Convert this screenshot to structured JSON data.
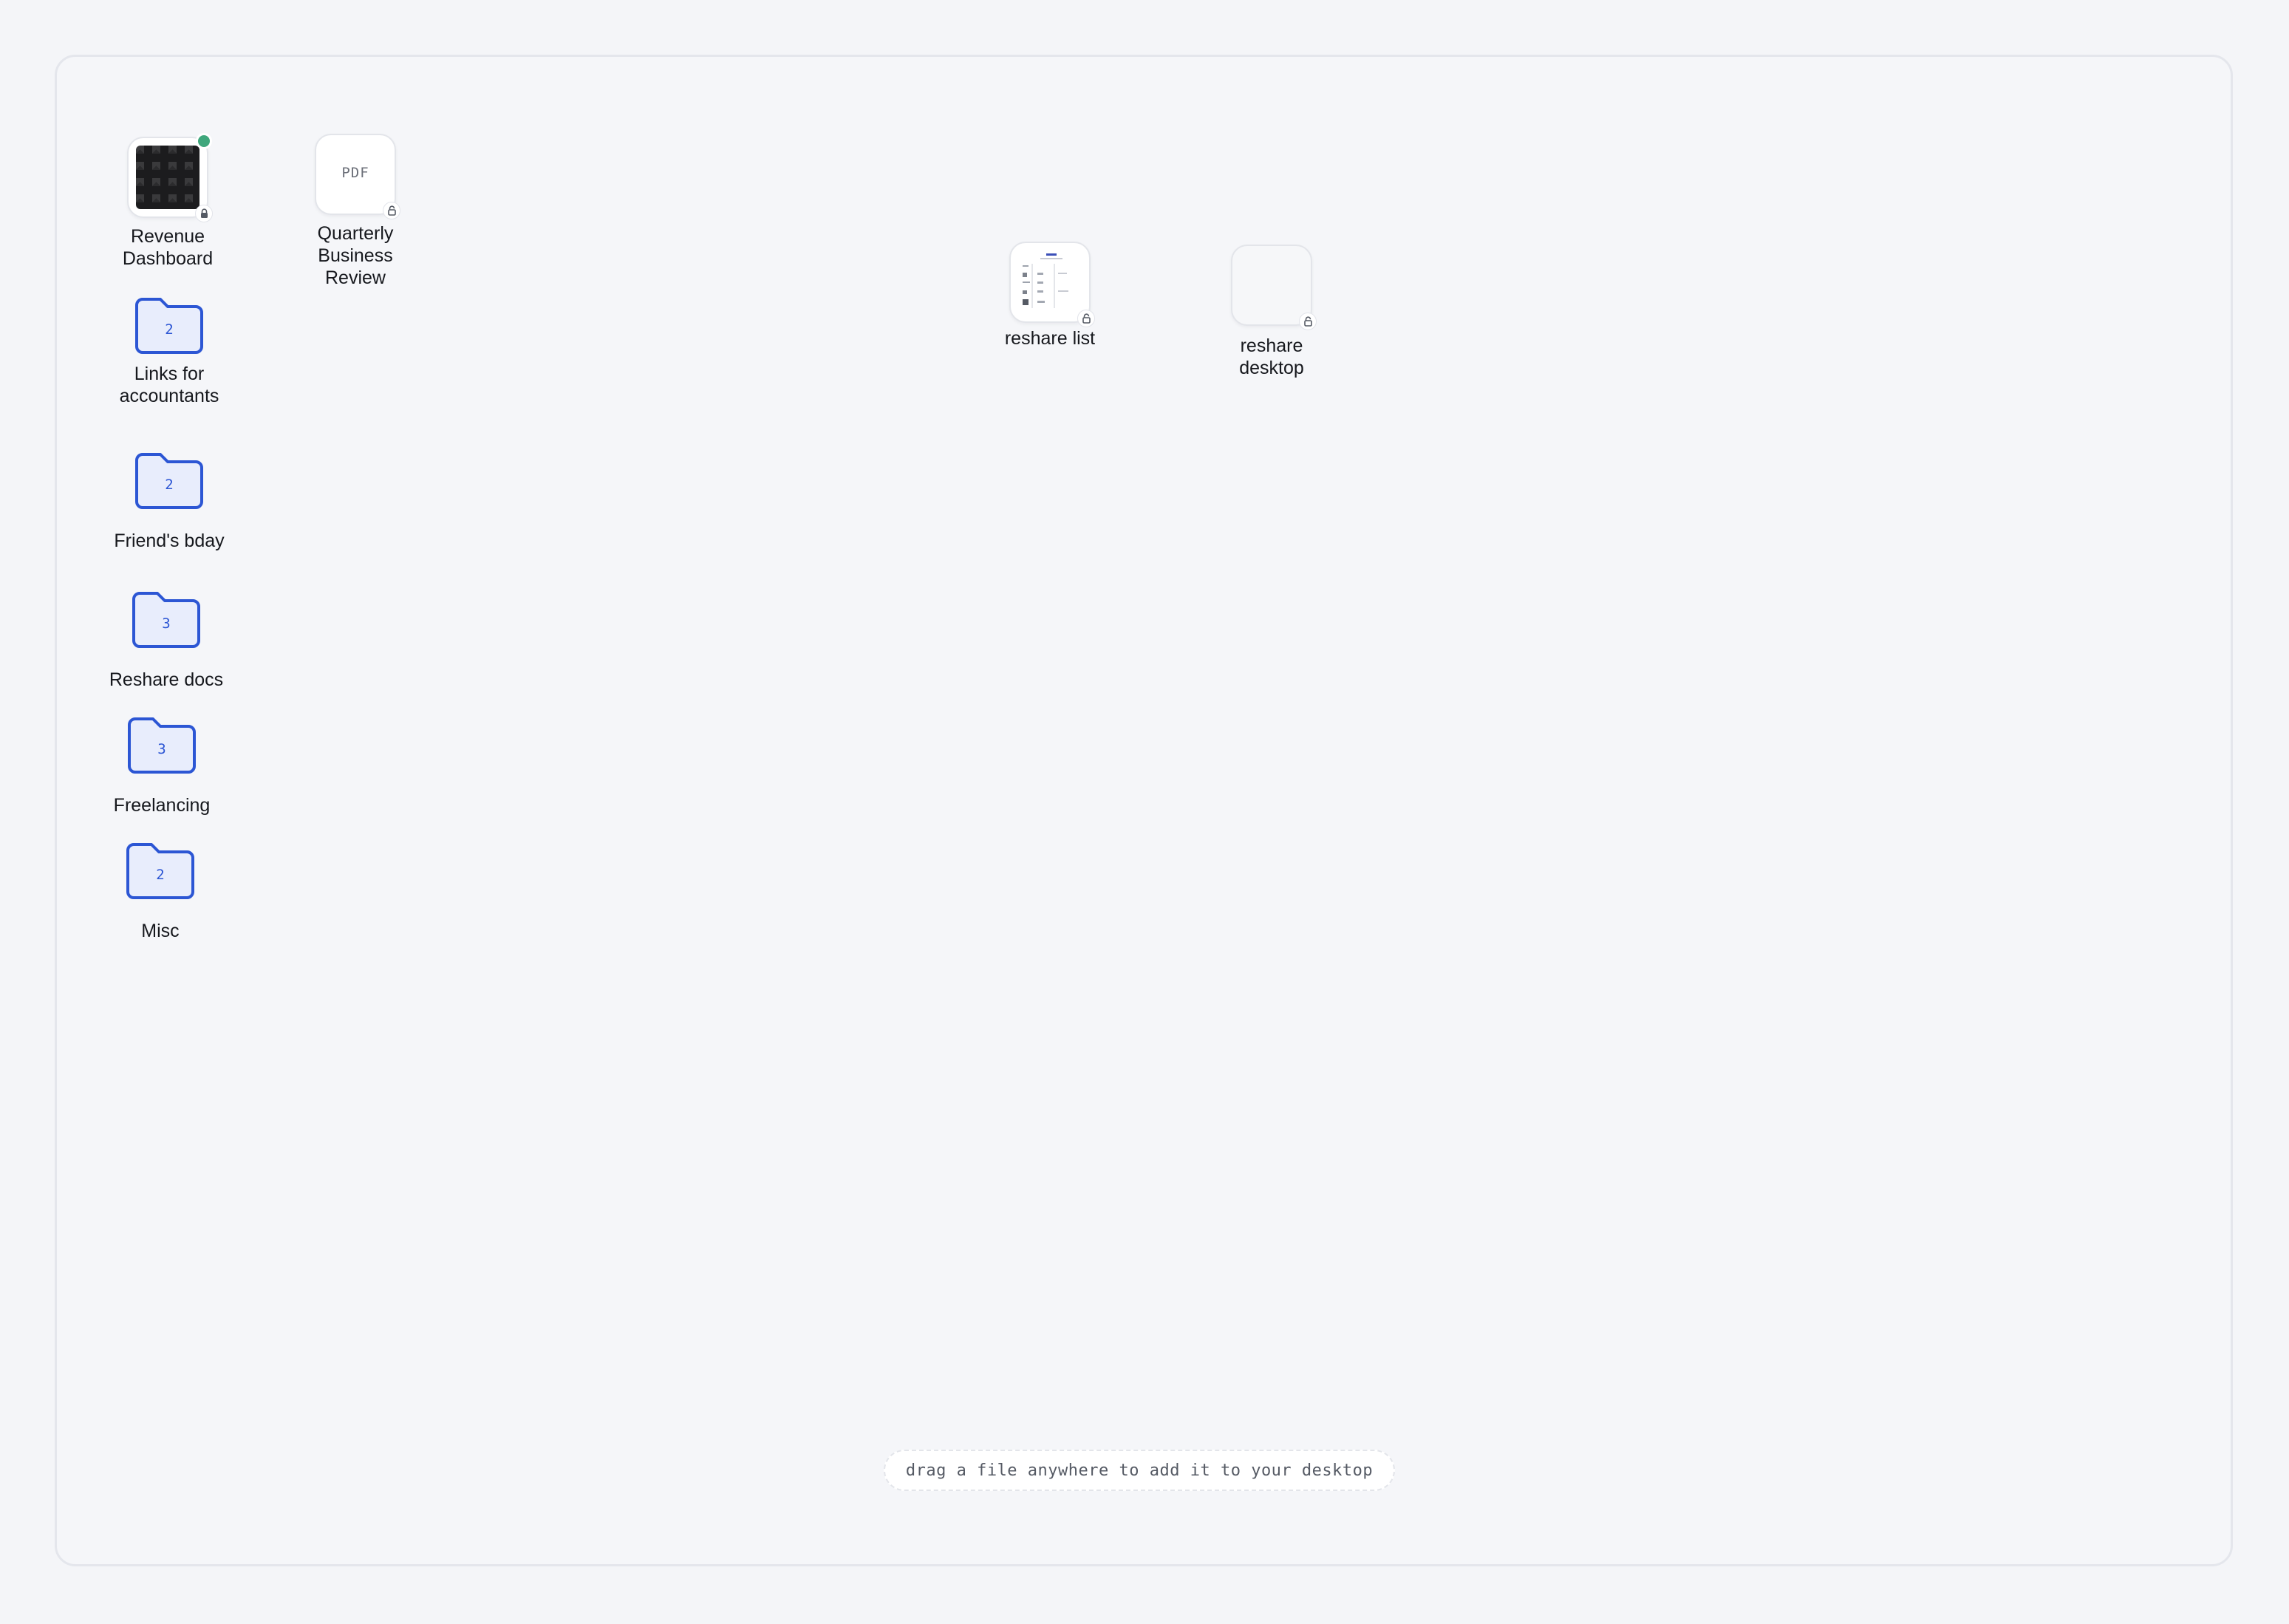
{
  "desktop": {
    "items": [
      {
        "kind": "image",
        "label": "Revenue Dashboard",
        "status": "online",
        "locked": true
      },
      {
        "kind": "pdf",
        "label": "Quarterly Business Review",
        "badge_text": "PDF",
        "locked": false
      },
      {
        "kind": "folder",
        "label": "Links for accountants",
        "count": "2"
      },
      {
        "kind": "folder",
        "label": "Friend's bday",
        "count": "2"
      },
      {
        "kind": "folder",
        "label": "Reshare docs",
        "count": "3"
      },
      {
        "kind": "folder",
        "label": "Freelancing",
        "count": "3"
      },
      {
        "kind": "folder",
        "label": "Misc",
        "count": "2"
      },
      {
        "kind": "document",
        "label": "reshare list",
        "locked": false
      },
      {
        "kind": "document",
        "label": "reshare desktop",
        "locked": false
      }
    ],
    "hint": "drag a file anywhere to add it to your desktop"
  },
  "colors": {
    "folder_stroke": "#2c56d4",
    "folder_fill": "#e8edfc",
    "status_online": "#3fa77c"
  }
}
